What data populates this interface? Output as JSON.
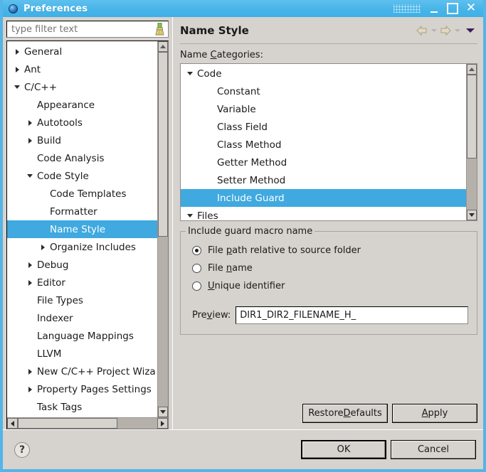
{
  "window": {
    "title": "Preferences",
    "icon": "eclipse-dot-icon",
    "minimize_label": "",
    "maximize_label": "",
    "close_label": "✕",
    "accent_color": "#48b4e8",
    "chrome_color": "#d6d2cd",
    "selection_color": "#3fa9e0"
  },
  "filter": {
    "placeholder": "type filter text",
    "value": "",
    "clear_icon": "broom-icon"
  },
  "sidebar": {
    "items": [
      {
        "label": "General",
        "indent": 0,
        "twisty": "collapsed",
        "selected": false
      },
      {
        "label": "Ant",
        "indent": 0,
        "twisty": "collapsed",
        "selected": false
      },
      {
        "label": "C/C++",
        "indent": 0,
        "twisty": "expanded",
        "selected": false
      },
      {
        "label": "Appearance",
        "indent": 1,
        "twisty": "none",
        "selected": false
      },
      {
        "label": "Autotools",
        "indent": 1,
        "twisty": "collapsed",
        "selected": false
      },
      {
        "label": "Build",
        "indent": 1,
        "twisty": "collapsed",
        "selected": false
      },
      {
        "label": "Code Analysis",
        "indent": 1,
        "twisty": "none",
        "selected": false
      },
      {
        "label": "Code Style",
        "indent": 1,
        "twisty": "expanded",
        "selected": false
      },
      {
        "label": "Code Templates",
        "indent": 2,
        "twisty": "none",
        "selected": false
      },
      {
        "label": "Formatter",
        "indent": 2,
        "twisty": "none",
        "selected": false
      },
      {
        "label": "Name Style",
        "indent": 2,
        "twisty": "none",
        "selected": true
      },
      {
        "label": "Organize Includes",
        "indent": 2,
        "twisty": "collapsed",
        "selected": false
      },
      {
        "label": "Debug",
        "indent": 1,
        "twisty": "collapsed",
        "selected": false
      },
      {
        "label": "Editor",
        "indent": 1,
        "twisty": "collapsed",
        "selected": false
      },
      {
        "label": "File Types",
        "indent": 1,
        "twisty": "none",
        "selected": false
      },
      {
        "label": "Indexer",
        "indent": 1,
        "twisty": "none",
        "selected": false
      },
      {
        "label": "Language Mappings",
        "indent": 1,
        "twisty": "none",
        "selected": false
      },
      {
        "label": "LLVM",
        "indent": 1,
        "twisty": "none",
        "selected": false
      },
      {
        "label": "New C/C++ Project Wiza",
        "indent": 1,
        "twisty": "collapsed",
        "selected": false
      },
      {
        "label": "Property Pages Settings",
        "indent": 1,
        "twisty": "collapsed",
        "selected": false
      },
      {
        "label": "Task Tags",
        "indent": 1,
        "twisty": "none",
        "selected": false
      }
    ]
  },
  "page": {
    "title": "Name Style",
    "back_icon": "back-arrow-icon",
    "forward_icon": "forward-arrow-icon",
    "menu_icon": "view-menu-caret-icon",
    "categories_label": "Name Categories:",
    "categories": [
      {
        "label": "Code",
        "indent": 0,
        "twisty": "expanded",
        "selected": false
      },
      {
        "label": "Constant",
        "indent": 1,
        "twisty": "none",
        "selected": false
      },
      {
        "label": "Variable",
        "indent": 1,
        "twisty": "none",
        "selected": false
      },
      {
        "label": "Class Field",
        "indent": 1,
        "twisty": "none",
        "selected": false
      },
      {
        "label": "Class Method",
        "indent": 1,
        "twisty": "none",
        "selected": false
      },
      {
        "label": "Getter Method",
        "indent": 1,
        "twisty": "none",
        "selected": false
      },
      {
        "label": "Setter Method",
        "indent": 1,
        "twisty": "none",
        "selected": false
      },
      {
        "label": "Include Guard",
        "indent": 1,
        "twisty": "none",
        "selected": true
      },
      {
        "label": "Files",
        "indent": 0,
        "twisty": "expanded",
        "selected": false
      }
    ],
    "group": {
      "title": "Include guard macro name",
      "options": [
        {
          "label": "File path relative to source folder",
          "checked": true
        },
        {
          "label": "File name",
          "checked": false
        },
        {
          "label": "Unique identifier",
          "checked": false
        }
      ],
      "preview_label": "Preview:",
      "preview_value": "DIR1_DIR2_FILENAME_H_"
    },
    "restore_defaults_label": "Restore Defaults",
    "apply_label": "Apply"
  },
  "footer": {
    "help_icon": "help-question-icon",
    "help_glyph": "?",
    "ok_label": "OK",
    "cancel_label": "Cancel"
  }
}
